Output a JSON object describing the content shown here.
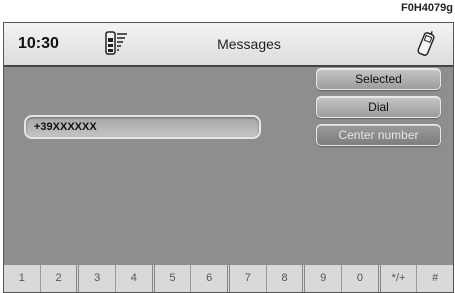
{
  "figure_code": "F0H4079g",
  "header": {
    "time": "10:30",
    "title": "Messages"
  },
  "number_field": {
    "value": "+39XXXXXX"
  },
  "menu": {
    "items": [
      {
        "label": "Selected",
        "state": "normal"
      },
      {
        "label": "Dial",
        "state": "normal"
      },
      {
        "label": "Center number",
        "state": "dimmed"
      }
    ]
  },
  "keypad": {
    "keys": [
      "1",
      "2",
      "3",
      "4",
      "5",
      "6",
      "7",
      "8",
      "9",
      "0",
      "*/+",
      "#"
    ]
  },
  "icons": {
    "signal": "signal-strength-icon",
    "phone": "phone-icon"
  },
  "colors": {
    "screen_bg": "#8e8e8e",
    "header_bg": "#e8e8e8",
    "keypad_bg": "#d9d9d9"
  }
}
